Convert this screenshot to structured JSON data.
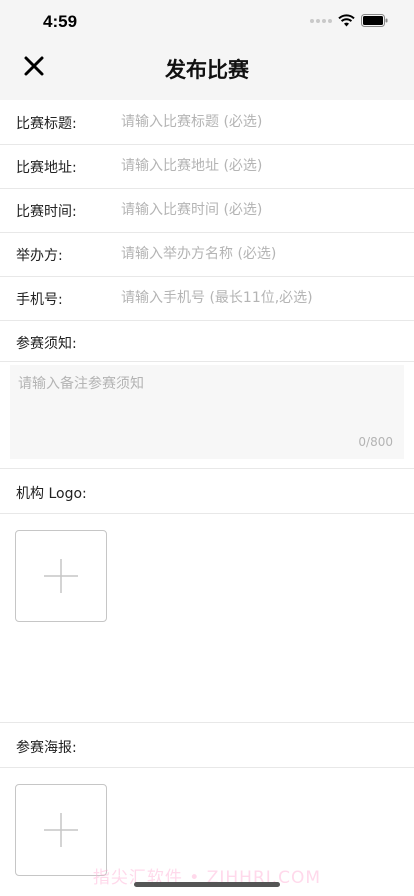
{
  "status_bar": {
    "time": "4:59"
  },
  "header": {
    "title": "发布比赛",
    "close_icon": "close-icon"
  },
  "form": {
    "fields": [
      {
        "label": "比赛标题:",
        "placeholder": "请输入比赛标题 (必选)",
        "value": ""
      },
      {
        "label": "比赛地址:",
        "placeholder": "请输入比赛地址 (必选)",
        "value": ""
      },
      {
        "label": "比赛时间:",
        "placeholder": "请输入比赛时间 (必选)",
        "value": ""
      },
      {
        "label": "举办方:",
        "placeholder": "请输入举办方名称 (必选)",
        "value": ""
      },
      {
        "label": "手机号:",
        "placeholder": "请输入手机号 (最长11位,必选)",
        "value": ""
      }
    ],
    "notes": {
      "label": "参赛须知:",
      "placeholder": "请输入备注参赛须知",
      "counter": "0/800"
    },
    "logo": {
      "label": "机构 Logo:",
      "upload_icon": "plus-icon"
    },
    "poster": {
      "label": "参赛海报:",
      "upload_icon": "plus-icon"
    }
  },
  "watermark": "指尖汇软件 • ZJHHRJ.COM",
  "colors": {
    "background": "#ffffff",
    "header_bg": "#f5f5f5",
    "placeholder": "#b4b4b4",
    "divider": "#e8e8e8"
  }
}
